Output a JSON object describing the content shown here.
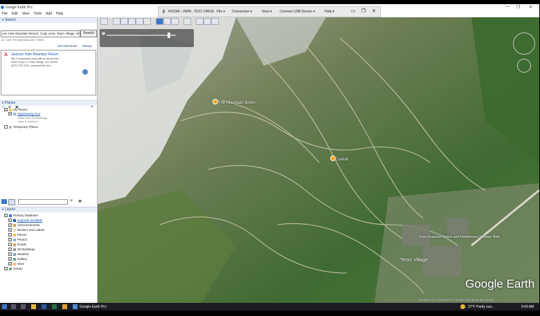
{
  "window": {
    "title": "Google Earth Pro",
    "controls": [
      "—",
      "❐",
      "✕"
    ]
  },
  "menu": [
    "File",
    "Edit",
    "View",
    "Tools",
    "Add",
    "Help"
  ],
  "vmware": {
    "title": "NVIDIA - VMW...TEST DRIVE",
    "menus": [
      "File ▾",
      "Connection ▾",
      "View ▾",
      "Connect USB Device ▾",
      "Help ▾"
    ]
  },
  "search": {
    "header": "Search",
    "query": "oon Hole Mountain Resort, Cody Lane, Teton Village, WY",
    "button": "Search",
    "hint": "ex: 1600 Pennsylvania Ave, 20500",
    "get_directions": "Get Directions",
    "history": "History",
    "result": {
      "letter": "A",
      "title": "Jackson Hole Mountain Resort",
      "lines": [
        "Ski & snowboard area with an aerial tram",
        "3395 Cody Ln, Teton Village, WY 83025",
        "(307) 733-2292 - jacksonhole.com"
      ]
    }
  },
  "places": {
    "header": "Places",
    "items": [
      {
        "label": "My Places",
        "level": 0
      },
      {
        "label": "Sightseeing Tour",
        "level": 1,
        "link": true
      },
      {
        "label": "Make sure 3D Buildings",
        "level": 2,
        "sub": true
      },
      {
        "label": "layer is checked",
        "level": 2,
        "sub": true
      },
      {
        "label": "Temporary Places",
        "level": 0
      }
    ]
  },
  "layers": {
    "header": "Layers",
    "items": [
      {
        "label": "Primary Database",
        "level": 0
      },
      {
        "label": "Upgrade available",
        "level": 1,
        "link": true
      },
      {
        "label": "Announcements",
        "level": 1
      },
      {
        "label": "Borders and Labels",
        "level": 1
      },
      {
        "label": "Places",
        "level": 1
      },
      {
        "label": "Photos",
        "level": 1
      },
      {
        "label": "Roads",
        "level": 1
      },
      {
        "label": "3D Buildings",
        "level": 1
      },
      {
        "label": "Weather",
        "level": 1
      },
      {
        "label": "Gallery",
        "level": 1
      },
      {
        "label": "More",
        "level": 1
      },
      {
        "label": "Terrain",
        "level": 0
      }
    ]
  },
  "map": {
    "labels": [
      {
        "text": "The Mountain Bistro"
      },
      {
        "text": "Couloir"
      },
      {
        "text": "Four Seasons Resort and Residences Jackson Hole"
      },
      {
        "text": "Teton Village"
      }
    ],
    "logo": "Google Earth",
    "status": "43°36'45.70\" N  110°49'22.37\" W  elev  6487 ft  eye alt  21100 ft"
  },
  "taskbar": {
    "app": "Google Earth Pro",
    "weather": "37°F  Partly sun...",
    "time": "9:43 AM"
  },
  "colors": {
    "accent": "#1a55b3",
    "header": "#1a3d7c",
    "taskbar": "#1c1c24"
  }
}
